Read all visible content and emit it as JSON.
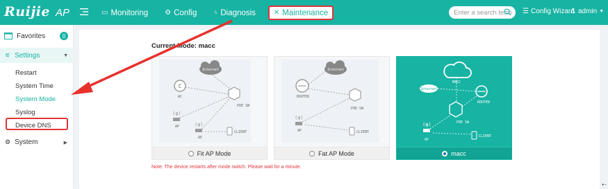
{
  "app": {
    "brand": "Ruijie",
    "product": "AP"
  },
  "nav": {
    "items": [
      {
        "label": "Monitoring",
        "icon": "monitor-icon"
      },
      {
        "label": "Config",
        "icon": "gear-icon"
      },
      {
        "label": "Diagnosis",
        "icon": "diagnosis-icon"
      },
      {
        "label": "Maintenance",
        "icon": "tools-icon"
      }
    ],
    "active": "Maintenance"
  },
  "search": {
    "placeholder": "Enter a search term"
  },
  "header": {
    "wizard_label": "Config Wizard",
    "user_label": "admin"
  },
  "sidebar": {
    "favorites": {
      "label": "Favorites",
      "count": "0"
    },
    "settings": {
      "label": "Settings"
    },
    "sub_items": [
      "Restart",
      "System Time",
      "System Mode",
      "Syslog",
      "Device DNS"
    ],
    "active_sub": "System Mode",
    "system": {
      "label": "System"
    }
  },
  "main": {
    "current_mode_label": "Current Mode:",
    "current_mode_value": "macc",
    "modes": [
      {
        "label": "Fit AP Mode",
        "selected": false,
        "diagram": {
          "cloud": "Internet",
          "controller": "AC",
          "switch": "POE SW",
          "ap": "AP",
          "client": "CLIENT"
        }
      },
      {
        "label": "Fat AP Mode",
        "selected": false,
        "diagram": {
          "cloud": "Internet",
          "router": "ROUTER",
          "switch": "POE SW",
          "ap": "AP",
          "client": "CLIENT"
        }
      },
      {
        "label": "macc",
        "selected": true,
        "diagram": {
          "cloud": "MACC",
          "internet": "Internet",
          "router": "ROUTER",
          "switch": "POE SW",
          "ap": "AP",
          "client": "CLIENT"
        }
      }
    ],
    "note": "Note: The device restarts after mode switch. Please wait for a minute."
  },
  "colors": {
    "brand": "#17b3a3",
    "highlight": "#e0343a",
    "arrow": "#e8302c"
  }
}
